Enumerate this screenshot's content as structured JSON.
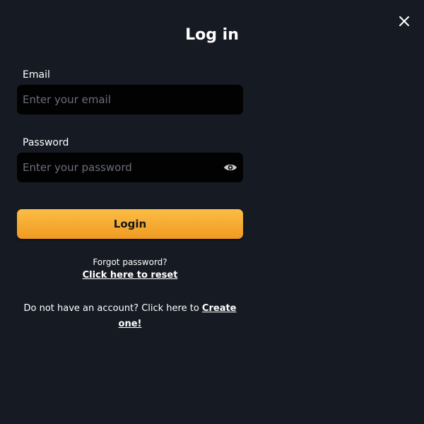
{
  "dialog": {
    "title": "Log in",
    "close_icon": "close-icon"
  },
  "email": {
    "label": "Email",
    "placeholder": "Enter your email",
    "value": ""
  },
  "password": {
    "label": "Password",
    "placeholder": "Enter your password",
    "value": "",
    "toggle_icon": "eye-icon"
  },
  "login_button": {
    "label": "Login"
  },
  "forgot": {
    "prompt": "Forgot password?",
    "link": "Click here to reset"
  },
  "signup": {
    "prompt": "Do not have an account? Click here to ",
    "link": "Create one!"
  },
  "colors": {
    "background": "#161a23",
    "input_background": "#020203",
    "button_gradient_top": "#fbbd45",
    "button_gradient_bottom": "#f09a22",
    "placeholder": "#6b6f78"
  }
}
